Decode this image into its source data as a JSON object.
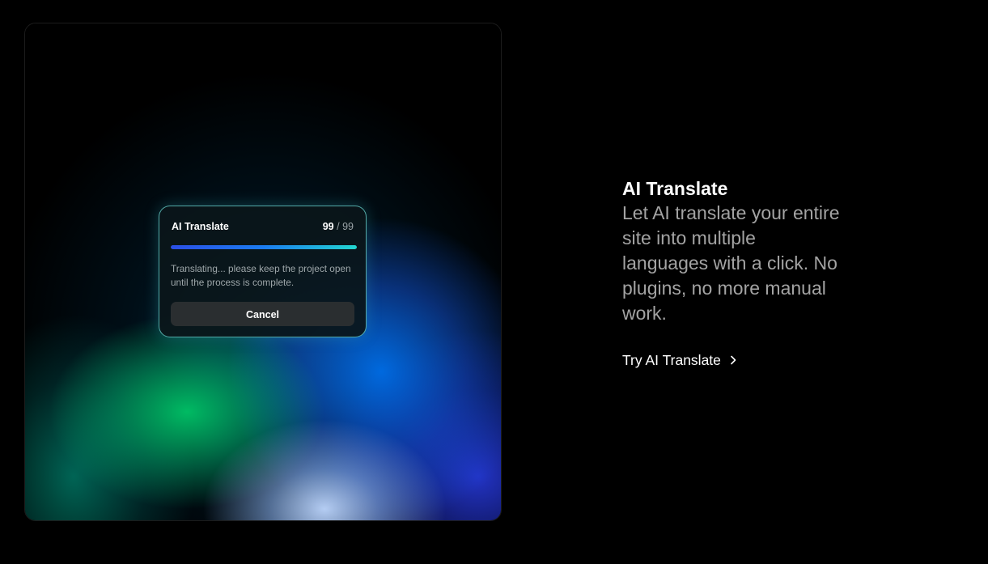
{
  "dialog": {
    "title": "AI Translate",
    "progress_current": "99",
    "progress_separator": "/",
    "progress_total": "99",
    "progress_fraction": 1.0,
    "message": "Translating... please keep the project open until the process is complete.",
    "cancel_label": "Cancel"
  },
  "feature": {
    "title": "AI Translate",
    "description": "Let AI translate your entire site into multiple languages with a click. No plugins, no more manual work.",
    "link_label": "Try AI Translate",
    "link_icon": "chevron-right-icon"
  },
  "colors": {
    "background": "#000000",
    "dialog_border": "#6edcd7",
    "progress_start": "#2b4fe6",
    "progress_end": "#22d6d0",
    "description_text": "#a3a3a3"
  }
}
